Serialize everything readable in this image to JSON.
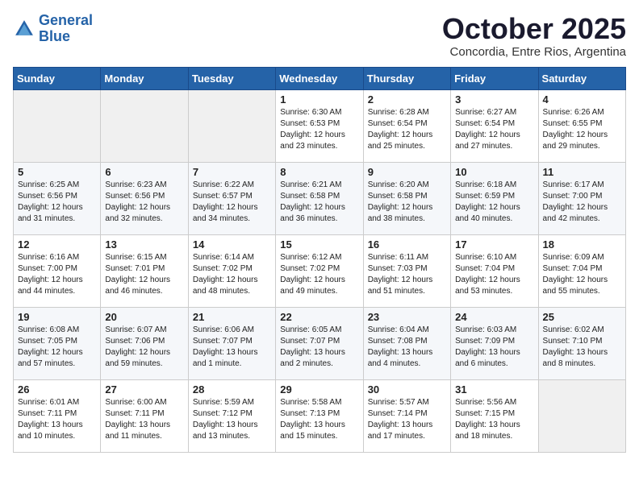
{
  "logo": {
    "line1": "General",
    "line2": "Blue"
  },
  "title": "October 2025",
  "subtitle": "Concordia, Entre Rios, Argentina",
  "weekdays": [
    "Sunday",
    "Monday",
    "Tuesday",
    "Wednesday",
    "Thursday",
    "Friday",
    "Saturday"
  ],
  "weeks": [
    [
      {
        "day": "",
        "info": ""
      },
      {
        "day": "",
        "info": ""
      },
      {
        "day": "",
        "info": ""
      },
      {
        "day": "1",
        "info": "Sunrise: 6:30 AM\nSunset: 6:53 PM\nDaylight: 12 hours\nand 23 minutes."
      },
      {
        "day": "2",
        "info": "Sunrise: 6:28 AM\nSunset: 6:54 PM\nDaylight: 12 hours\nand 25 minutes."
      },
      {
        "day": "3",
        "info": "Sunrise: 6:27 AM\nSunset: 6:54 PM\nDaylight: 12 hours\nand 27 minutes."
      },
      {
        "day": "4",
        "info": "Sunrise: 6:26 AM\nSunset: 6:55 PM\nDaylight: 12 hours\nand 29 minutes."
      }
    ],
    [
      {
        "day": "5",
        "info": "Sunrise: 6:25 AM\nSunset: 6:56 PM\nDaylight: 12 hours\nand 31 minutes."
      },
      {
        "day": "6",
        "info": "Sunrise: 6:23 AM\nSunset: 6:56 PM\nDaylight: 12 hours\nand 32 minutes."
      },
      {
        "day": "7",
        "info": "Sunrise: 6:22 AM\nSunset: 6:57 PM\nDaylight: 12 hours\nand 34 minutes."
      },
      {
        "day": "8",
        "info": "Sunrise: 6:21 AM\nSunset: 6:58 PM\nDaylight: 12 hours\nand 36 minutes."
      },
      {
        "day": "9",
        "info": "Sunrise: 6:20 AM\nSunset: 6:58 PM\nDaylight: 12 hours\nand 38 minutes."
      },
      {
        "day": "10",
        "info": "Sunrise: 6:18 AM\nSunset: 6:59 PM\nDaylight: 12 hours\nand 40 minutes."
      },
      {
        "day": "11",
        "info": "Sunrise: 6:17 AM\nSunset: 7:00 PM\nDaylight: 12 hours\nand 42 minutes."
      }
    ],
    [
      {
        "day": "12",
        "info": "Sunrise: 6:16 AM\nSunset: 7:00 PM\nDaylight: 12 hours\nand 44 minutes."
      },
      {
        "day": "13",
        "info": "Sunrise: 6:15 AM\nSunset: 7:01 PM\nDaylight: 12 hours\nand 46 minutes."
      },
      {
        "day": "14",
        "info": "Sunrise: 6:14 AM\nSunset: 7:02 PM\nDaylight: 12 hours\nand 48 minutes."
      },
      {
        "day": "15",
        "info": "Sunrise: 6:12 AM\nSunset: 7:02 PM\nDaylight: 12 hours\nand 49 minutes."
      },
      {
        "day": "16",
        "info": "Sunrise: 6:11 AM\nSunset: 7:03 PM\nDaylight: 12 hours\nand 51 minutes."
      },
      {
        "day": "17",
        "info": "Sunrise: 6:10 AM\nSunset: 7:04 PM\nDaylight: 12 hours\nand 53 minutes."
      },
      {
        "day": "18",
        "info": "Sunrise: 6:09 AM\nSunset: 7:04 PM\nDaylight: 12 hours\nand 55 minutes."
      }
    ],
    [
      {
        "day": "19",
        "info": "Sunrise: 6:08 AM\nSunset: 7:05 PM\nDaylight: 12 hours\nand 57 minutes."
      },
      {
        "day": "20",
        "info": "Sunrise: 6:07 AM\nSunset: 7:06 PM\nDaylight: 12 hours\nand 59 minutes."
      },
      {
        "day": "21",
        "info": "Sunrise: 6:06 AM\nSunset: 7:07 PM\nDaylight: 13 hours\nand 1 minute."
      },
      {
        "day": "22",
        "info": "Sunrise: 6:05 AM\nSunset: 7:07 PM\nDaylight: 13 hours\nand 2 minutes."
      },
      {
        "day": "23",
        "info": "Sunrise: 6:04 AM\nSunset: 7:08 PM\nDaylight: 13 hours\nand 4 minutes."
      },
      {
        "day": "24",
        "info": "Sunrise: 6:03 AM\nSunset: 7:09 PM\nDaylight: 13 hours\nand 6 minutes."
      },
      {
        "day": "25",
        "info": "Sunrise: 6:02 AM\nSunset: 7:10 PM\nDaylight: 13 hours\nand 8 minutes."
      }
    ],
    [
      {
        "day": "26",
        "info": "Sunrise: 6:01 AM\nSunset: 7:11 PM\nDaylight: 13 hours\nand 10 minutes."
      },
      {
        "day": "27",
        "info": "Sunrise: 6:00 AM\nSunset: 7:11 PM\nDaylight: 13 hours\nand 11 minutes."
      },
      {
        "day": "28",
        "info": "Sunrise: 5:59 AM\nSunset: 7:12 PM\nDaylight: 13 hours\nand 13 minutes."
      },
      {
        "day": "29",
        "info": "Sunrise: 5:58 AM\nSunset: 7:13 PM\nDaylight: 13 hours\nand 15 minutes."
      },
      {
        "day": "30",
        "info": "Sunrise: 5:57 AM\nSunset: 7:14 PM\nDaylight: 13 hours\nand 17 minutes."
      },
      {
        "day": "31",
        "info": "Sunrise: 5:56 AM\nSunset: 7:15 PM\nDaylight: 13 hours\nand 18 minutes."
      },
      {
        "day": "",
        "info": ""
      }
    ]
  ]
}
